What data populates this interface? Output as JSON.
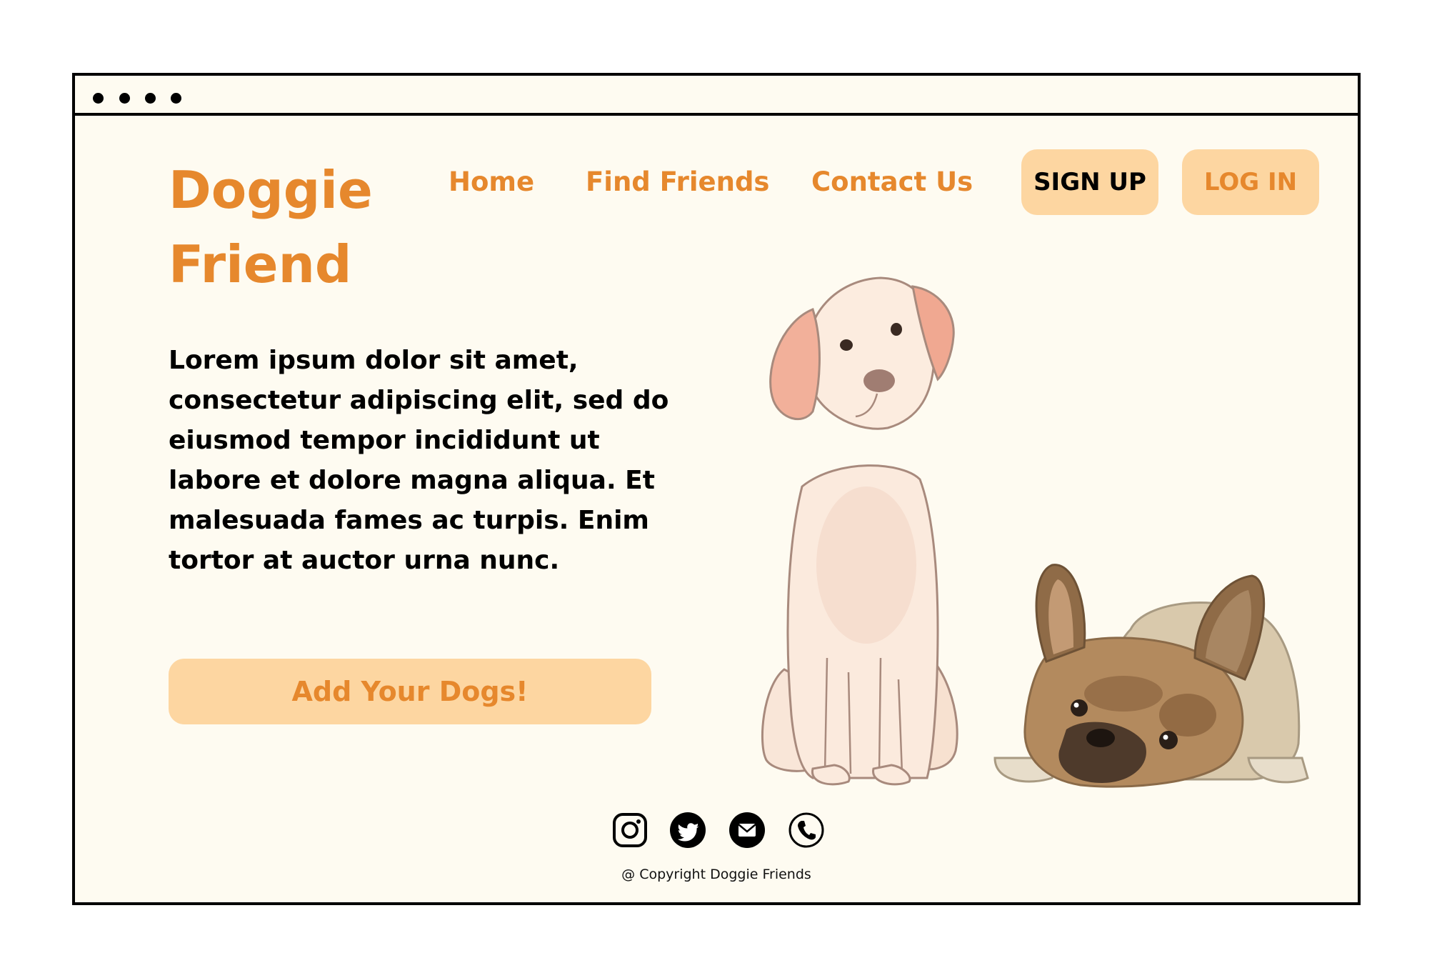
{
  "brand": {
    "name": "Doggie Friend"
  },
  "nav": {
    "items": [
      {
        "label": "Home"
      },
      {
        "label": "Find Friends"
      },
      {
        "label": "Contact Us"
      }
    ]
  },
  "auth": {
    "signup_label": "SIGN UP",
    "login_label": "LOG IN"
  },
  "hero": {
    "text": "Lorem ipsum dolor sit amet, consectetur adipiscing elit, sed do eiusmod tempor incididunt ut labore et dolore magna aliqua. Et malesuada fames ac turpis. Enim tortor at auctor urna nunc.",
    "cta_label": "Add Your Dogs!"
  },
  "illustration": {
    "subjects": [
      "labrador-puppy",
      "french-bulldog"
    ]
  },
  "footer": {
    "social": [
      "instagram-icon",
      "twitter-icon",
      "mail-icon",
      "phone-icon"
    ],
    "copyright": "@ Copyright Doggie Friends"
  },
  "colors": {
    "accent": "#e6882d",
    "button_bg": "#fdd6a1",
    "page_bg": "#fefbf1",
    "text": "#000000"
  }
}
